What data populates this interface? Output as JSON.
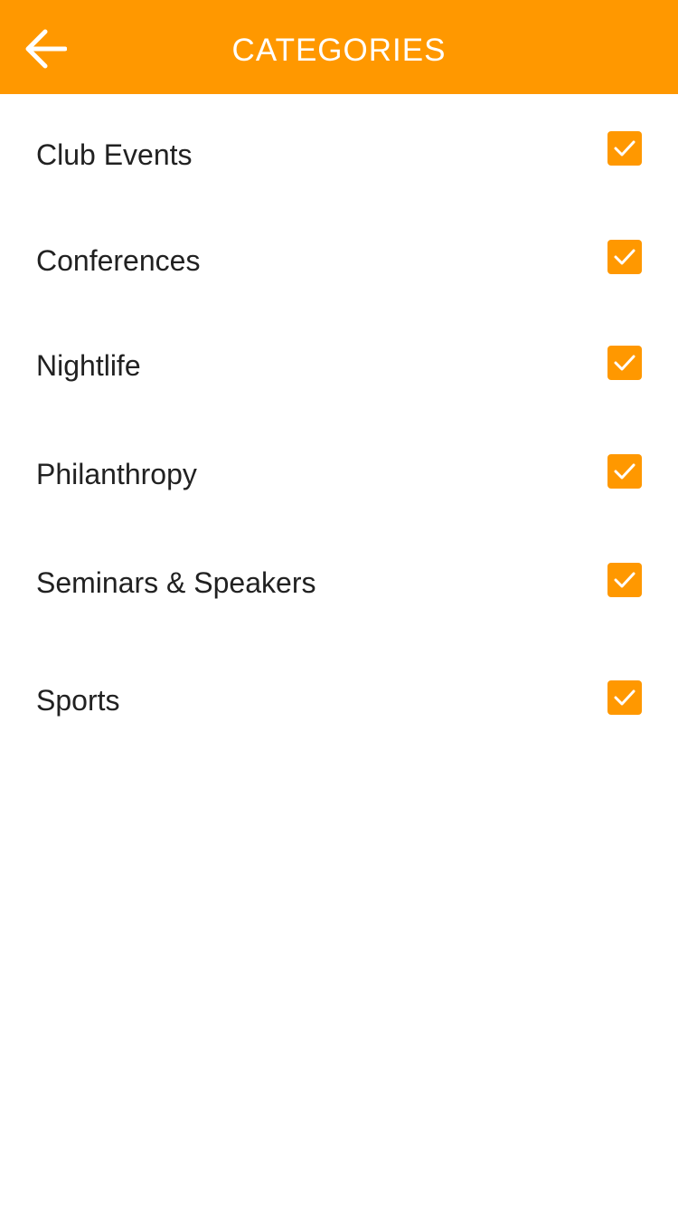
{
  "header": {
    "title": "CATEGORIES",
    "back_icon": "arrow-left-icon",
    "background_color": "#ff9800",
    "text_color": "#ffffff"
  },
  "categories": [
    {
      "label": "Club Events",
      "checked": true
    },
    {
      "label": "Conferences",
      "checked": true
    },
    {
      "label": "Nightlife",
      "checked": true
    },
    {
      "label": "Philanthropy",
      "checked": true
    },
    {
      "label": "Seminars & Speakers",
      "checked": true
    },
    {
      "label": "Sports",
      "checked": true
    }
  ],
  "checkbox": {
    "color": "#ff9800",
    "icon": "checkmark-icon"
  }
}
